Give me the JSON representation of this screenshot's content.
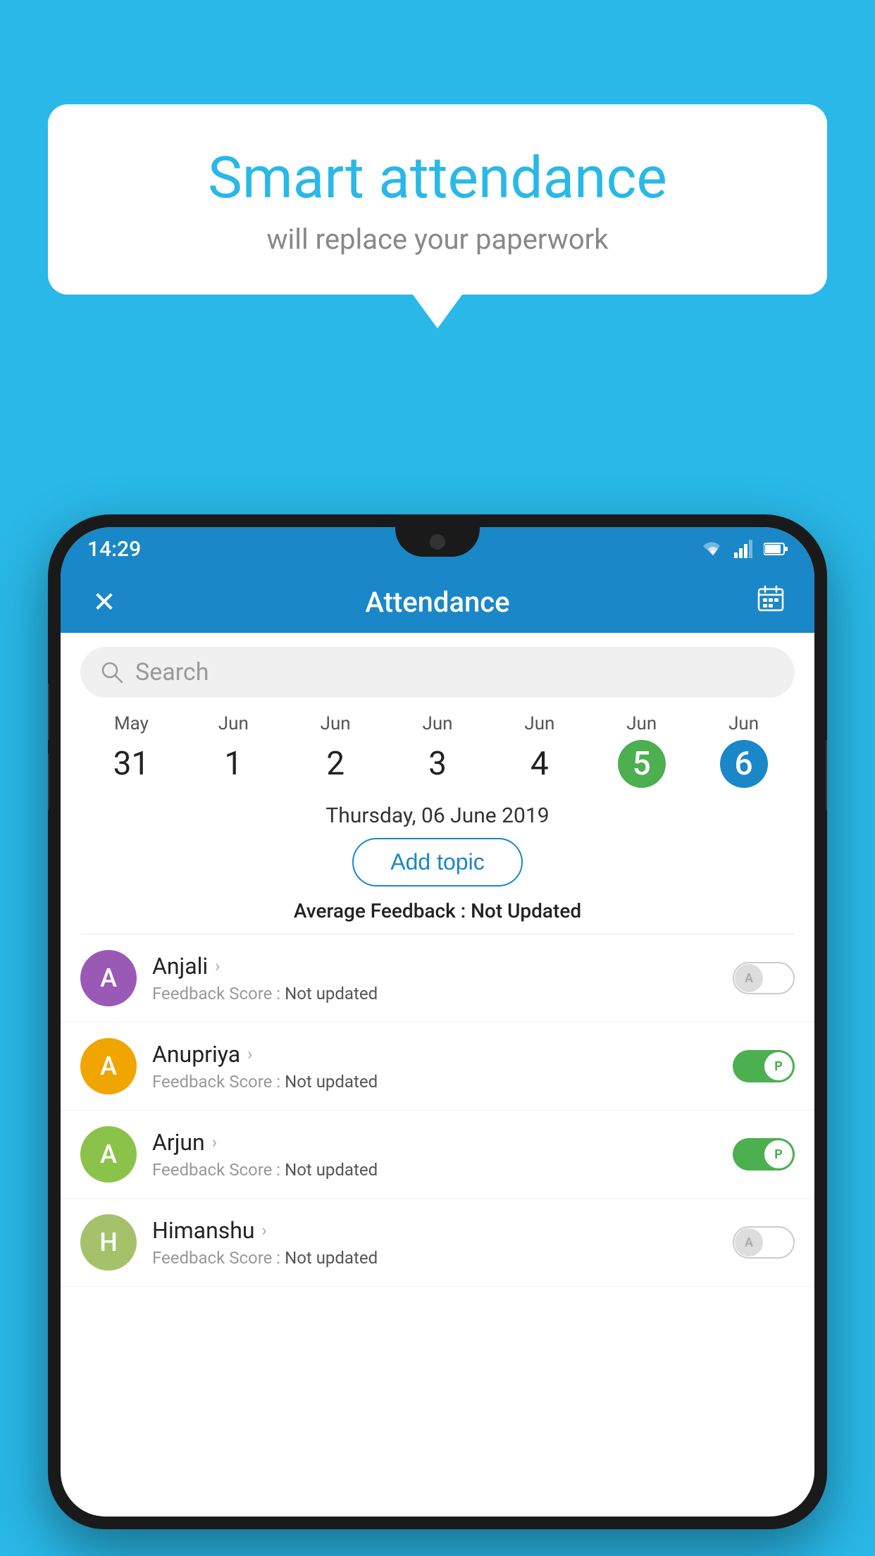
{
  "background_color": "#29b8e8",
  "bubble": {
    "title": "Smart attendance",
    "subtitle": "will replace your paperwork"
  },
  "status_bar": {
    "time": "14:29",
    "icons": [
      "wifi",
      "signal",
      "battery"
    ]
  },
  "app_bar": {
    "title": "Attendance",
    "close_label": "✕",
    "calendar_icon": "📅"
  },
  "search": {
    "placeholder": "Search"
  },
  "dates": [
    {
      "month": "May",
      "day": "31",
      "state": "normal"
    },
    {
      "month": "Jun",
      "day": "1",
      "state": "normal"
    },
    {
      "month": "Jun",
      "day": "2",
      "state": "normal"
    },
    {
      "month": "Jun",
      "day": "3",
      "state": "normal"
    },
    {
      "month": "Jun",
      "day": "4",
      "state": "normal"
    },
    {
      "month": "Jun",
      "day": "5",
      "state": "today"
    },
    {
      "month": "Jun",
      "day": "6",
      "state": "selected"
    }
  ],
  "selected_date_label": "Thursday, 06 June 2019",
  "add_topic_label": "Add topic",
  "avg_feedback_label": "Average Feedback : ",
  "avg_feedback_value": "Not Updated",
  "students": [
    {
      "name": "Anjali",
      "avatar_letter": "A",
      "avatar_color": "#9b59b6",
      "feedback_label": "Feedback Score : ",
      "feedback_value": "Not updated",
      "toggle": "off",
      "toggle_label": "A"
    },
    {
      "name": "Anupriya",
      "avatar_letter": "A",
      "avatar_color": "#f0a500",
      "feedback_label": "Feedback Score : ",
      "feedback_value": "Not updated",
      "toggle": "on",
      "toggle_label": "P"
    },
    {
      "name": "Arjun",
      "avatar_letter": "A",
      "avatar_color": "#8bc34a",
      "feedback_label": "Feedback Score : ",
      "feedback_value": "Not updated",
      "toggle": "on",
      "toggle_label": "P"
    },
    {
      "name": "Himanshu",
      "avatar_letter": "H",
      "avatar_color": "#a5c26b",
      "feedback_label": "Feedback Score : ",
      "feedback_value": "Not updated",
      "toggle": "off",
      "toggle_label": "A"
    }
  ]
}
